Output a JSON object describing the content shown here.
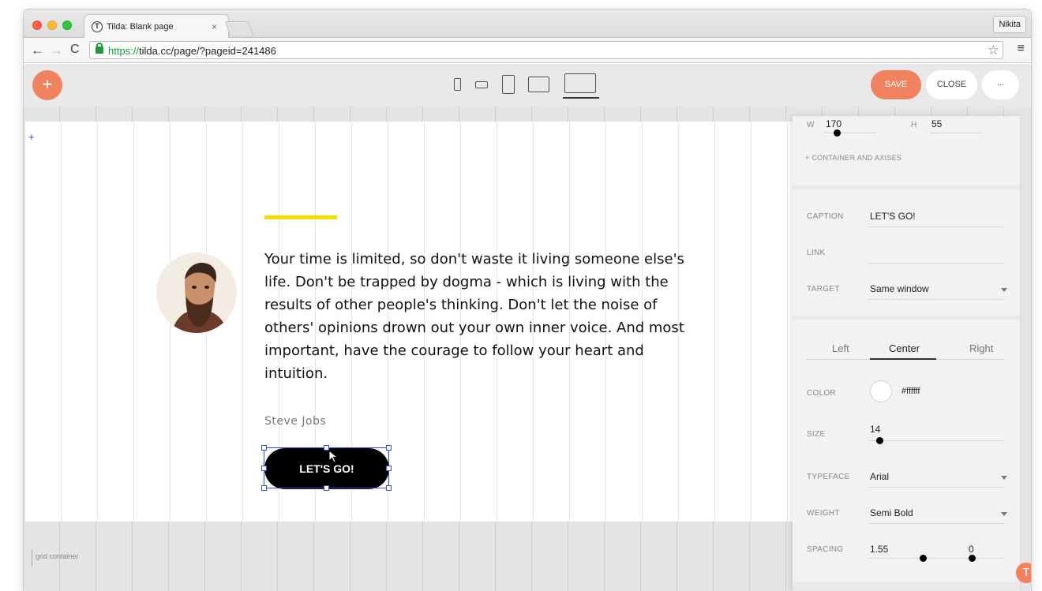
{
  "browser": {
    "tab_title": "Tilda: Blank page",
    "tab_close": "×",
    "tab_logo": "T",
    "profile_name": "Nikita",
    "url_scheme": "https://",
    "url_rest": "tilda.cc/page/?pageid=241486",
    "back": "←",
    "forward": "→",
    "reload": "C",
    "star": "☆",
    "menu": "≡"
  },
  "toolbar": {
    "add_label": "+",
    "save_label": "SAVE",
    "close_label": "CLOSE",
    "more_label": "..."
  },
  "canvas": {
    "corner_mark": "+",
    "quote": "Your time is limited, so don't waste it living someone else's life. Don't be trapped by dogma - which is living with the results of other people's thinking. Don't let the noise of others' opinions drown out your own inner voice. And most important, have the courage to follow your heart and intuition.",
    "author": "Steve Jobs",
    "button_label": "LET'S GO!",
    "grid_label": "grid container"
  },
  "panel": {
    "size": {
      "w_label": "W",
      "w_value": "170",
      "h_label": "H",
      "h_value": "55"
    },
    "container_link": "+ CONTAINER AND AXISES",
    "caption": {
      "label": "CAPTION",
      "value": "LET'S GO!"
    },
    "link": {
      "label": "LINK",
      "value": ""
    },
    "target": {
      "label": "TARGET",
      "value": "Same window"
    },
    "align": {
      "left": "Left",
      "center": "Center",
      "right": "Right",
      "selected": "Center"
    },
    "color": {
      "label": "COLOR",
      "value": "#ffffff"
    },
    "font_size": {
      "label": "SIZE",
      "value": "14"
    },
    "typeface": {
      "label": "TYPEFACE",
      "value": "Arial"
    },
    "weight": {
      "label": "WEIGHT",
      "value": "Semi Bold"
    },
    "spacing": {
      "label": "SPACING",
      "value": "1.55",
      "value2": "0"
    }
  },
  "badge": "T",
  "colors": {
    "accent": "#f0825f",
    "highlight_bar": "#f5dd00",
    "selection": "#3a4ad1",
    "cta_background": "#000000"
  }
}
